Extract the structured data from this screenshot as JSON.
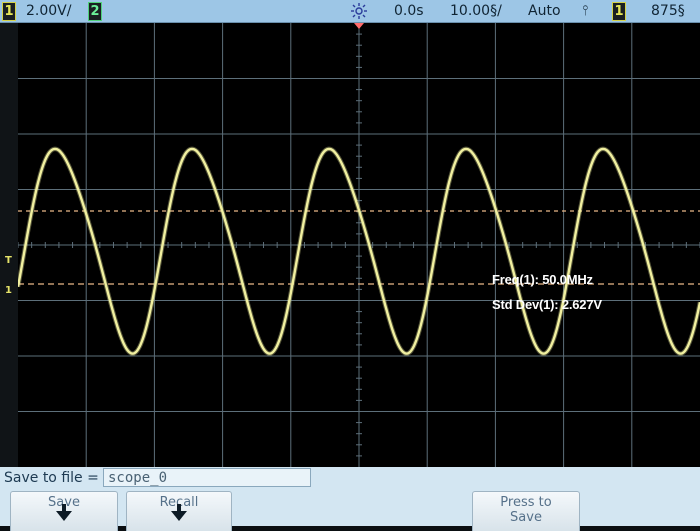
{
  "topbar": {
    "ch1_number": "1",
    "ch1_scale": "2.00V/",
    "ch2_number": "2",
    "acquire_icon": "sun-icon",
    "time_delay": "0.0s",
    "time_scale": "10.00§/",
    "trigger_mode": "Auto",
    "trigger_slope": "⫯",
    "trigger_source": "1",
    "trigger_level": "875§"
  },
  "screen": {
    "trigger_marker": "T",
    "ground_marker": "1",
    "measurements": [
      {
        "label": "Freq(1): 50.0MHz"
      },
      {
        "label": "Std Dev(1): 2.627V"
      }
    ],
    "colors": {
      "trace": "#f1f0a0",
      "grid": "#5d6f7a",
      "cursor": "#e9b888",
      "trigger_indicator": "#ff6b6b"
    }
  },
  "save": {
    "field_label": "Save to file =",
    "file_name": "scope_0",
    "softkeys": [
      {
        "label": "Save",
        "icon": "down-arrow-icon"
      },
      {
        "label": "Recall",
        "icon": "down-arrow-icon"
      },
      {
        "label": "Press to Save"
      }
    ]
  }
}
